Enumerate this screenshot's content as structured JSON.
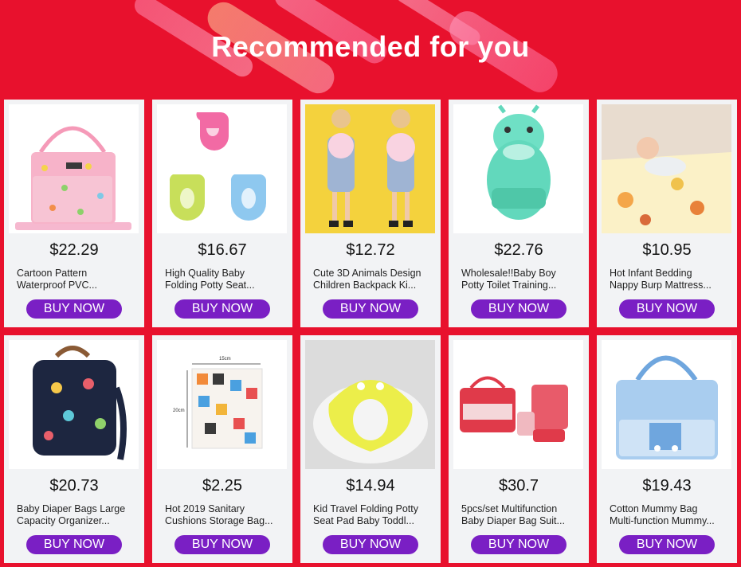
{
  "header": {
    "title": "Recommended for you"
  },
  "colors": {
    "background": "#e8112d",
    "button": "#7a1fc4",
    "card": "#f2f3f5"
  },
  "products": [
    {
      "price": "$22.29",
      "line1": "Cartoon Pattern",
      "line2": "Waterproof PVC...",
      "button": "BUY NOW",
      "image": "pink-diaper-bag-image"
    },
    {
      "price": "$16.67",
      "line1": "High Quality Baby",
      "line2": "Folding Potty Seat...",
      "button": "BUY NOW",
      "image": "folding-potty-seats-image"
    },
    {
      "price": "$12.72",
      "line1": "Cute 3D Animals Design",
      "line2": "Children Backpack Ki...",
      "button": "BUY NOW",
      "image": "kids-backpack-image"
    },
    {
      "price": "$22.76",
      "line1": "Wholesale!!Baby Boy",
      "line2": "Potty Toilet Training...",
      "button": "BUY NOW",
      "image": "cow-potty-urinal-image"
    },
    {
      "price": "$10.95",
      "line1": "Hot Infant Bedding",
      "line2": "Nappy Burp Mattress...",
      "button": "BUY NOW",
      "image": "baby-play-mat-image"
    },
    {
      "price": "$20.73",
      "line1": "Baby Diaper Bags Large",
      "line2": "Capacity Organizer...",
      "button": "BUY NOW",
      "image": "navy-diaper-backpack-image"
    },
    {
      "price": "$2.25",
      "line1": "Hot 2019 Sanitary",
      "line2": "Cushions Storage Bag...",
      "button": "BUY NOW",
      "image": "storage-bag-image",
      "dim_w": "15cm",
      "dim_h": "20cm"
    },
    {
      "price": "$14.94",
      "line1": "Kid Travel Folding Potty",
      "line2": "Seat Pad Baby Toddl...",
      "button": "BUY NOW",
      "image": "travel-potty-seat-image"
    },
    {
      "price": "$30.7",
      "line1": "5pcs/set Multifunction",
      "line2": "Baby Diaper Bag Suit...",
      "button": "BUY NOW",
      "image": "red-bag-set-image"
    },
    {
      "price": "$19.43",
      "line1": "Cotton Mummy Bag",
      "line2": "Multi-function Mummy...",
      "button": "BUY NOW",
      "image": "blue-mummy-bag-image"
    }
  ]
}
